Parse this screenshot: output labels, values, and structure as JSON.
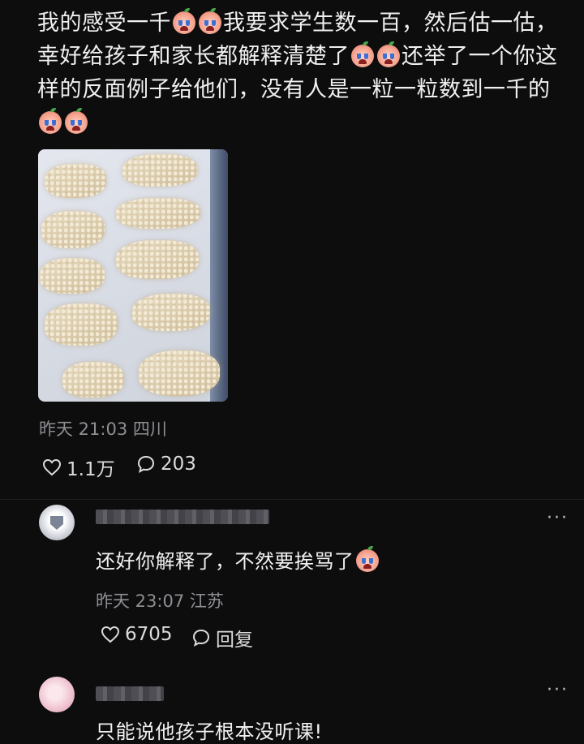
{
  "post": {
    "line1_a": "我的感受一千",
    "line1_b": "我要求学生数一百，然后估一估，",
    "line2_a": "幸好给孩子和家长都解释清楚了",
    "line2_b": "还举了一个你这",
    "line3": "样的反面例子给他们，没有人是一粒一粒数到一千的",
    "emoji_name": "crying-face-emoji",
    "meta": "昨天 21:03 四川",
    "likes": "1.1万",
    "comments": "203"
  },
  "comments": [
    {
      "text": "还好你解释了，不然要挨骂了",
      "meta": "昨天 23:07 江苏",
      "likes": "6705",
      "reply_label": "回复",
      "more": "···"
    },
    {
      "text": "只能说他孩子根本没听课!",
      "more": "···"
    }
  ],
  "colors": {
    "background": "#0d0d0e",
    "text": "#f0f0f0",
    "meta": "#8e8e93"
  }
}
